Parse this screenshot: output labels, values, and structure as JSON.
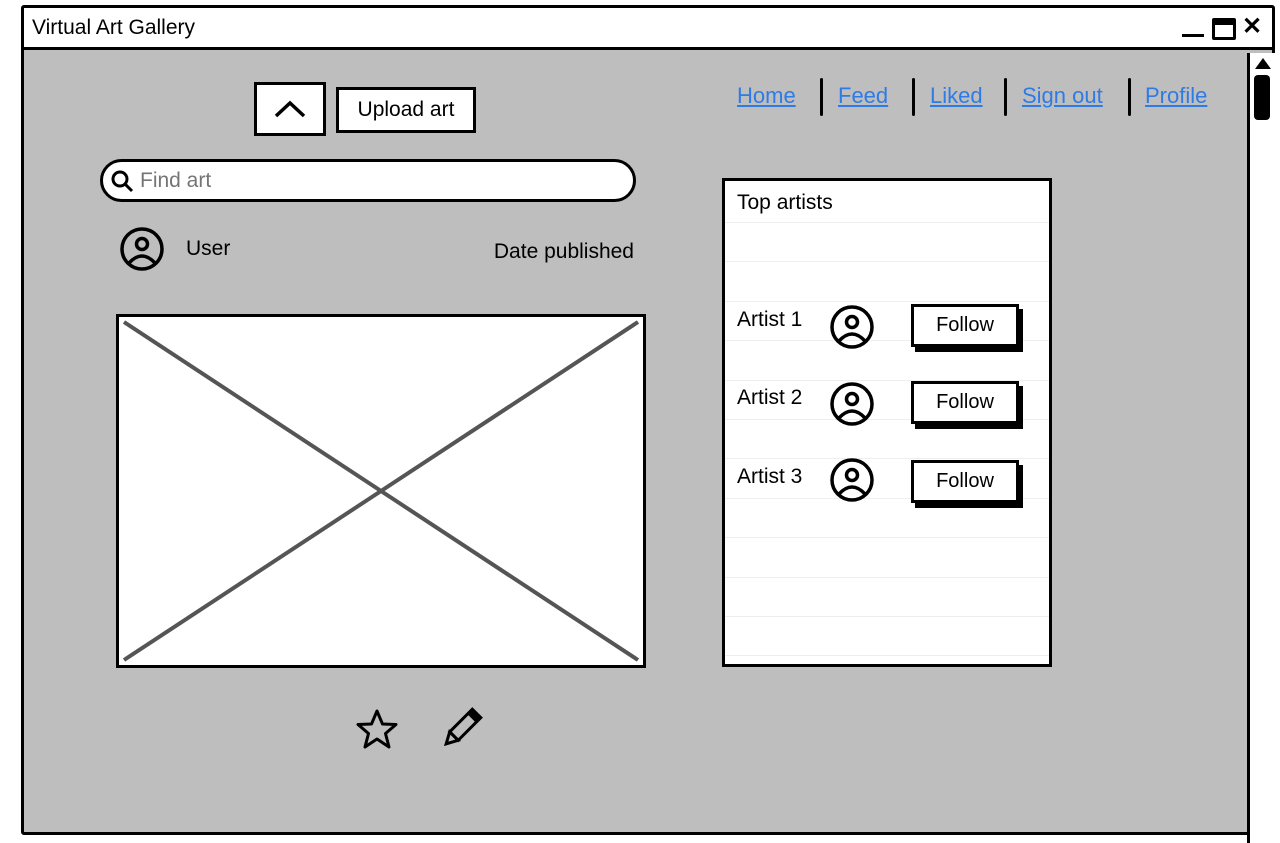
{
  "window": {
    "title": "Virtual Art Gallery",
    "controls": [
      "minimize-icon",
      "maximize-icon",
      "close-icon"
    ]
  },
  "toolbar": {
    "up_icon": "chevron-up-icon",
    "upload_label": "Upload art"
  },
  "search": {
    "placeholder": "Find art",
    "value": ""
  },
  "post": {
    "user": "User",
    "date_label": "Date published",
    "actions": [
      "star-icon",
      "pencil-icon"
    ]
  },
  "nav": {
    "links": [
      "Home",
      "Feed",
      "Liked",
      "Sign out",
      "Profile"
    ],
    "link_color": "#2f7be6"
  },
  "top_artists": {
    "title": "Top artists",
    "artists": [
      {
        "name": "Artist 1",
        "button": "Follow"
      },
      {
        "name": "Artist 2",
        "button": "Follow"
      },
      {
        "name": "Artist 3",
        "button": "Follow"
      }
    ]
  },
  "colors": {
    "background": "#bebebe",
    "border": "#000000"
  }
}
